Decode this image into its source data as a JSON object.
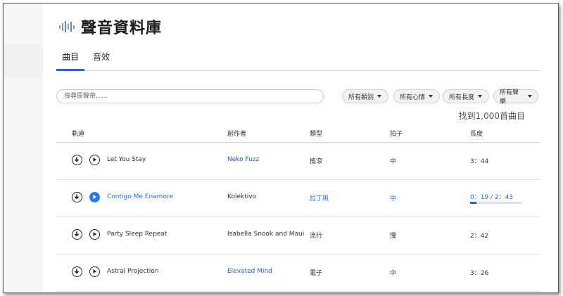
{
  "app": {
    "title": "聲音資料庫"
  },
  "tabs": [
    {
      "label": "曲目",
      "active": true
    },
    {
      "label": "音效",
      "active": false
    }
  ],
  "search": {
    "placeholder": "搜尋原聲帶......",
    "value": ""
  },
  "filters": [
    {
      "label": "所有類別"
    },
    {
      "label": "所有心情"
    },
    {
      "label": "所有長度"
    },
    {
      "label": "所有聲樂"
    }
  ],
  "result_count": "找到1,000首曲目",
  "columns": {
    "track": "軌道",
    "artist": "創作者",
    "genre": "類型",
    "tempo": "拍子",
    "length": "長度"
  },
  "tracks": [
    {
      "title": "Let You Stay",
      "artist": "Neko Fuzz",
      "genre": "搖滾",
      "tempo": "中",
      "length": "3：44",
      "playing": false
    },
    {
      "title": "Contigo Me Enamore",
      "artist": "Kolektivo",
      "genre": "拉丁風",
      "tempo": "中",
      "length": "0：19 / 2：43",
      "playing": true,
      "progress": 0.12
    },
    {
      "title": "Party Sleep Repeat",
      "artist": "Isabella Snook and Maui",
      "genre": "流行",
      "tempo": "慢",
      "length": "2：42",
      "playing": false
    },
    {
      "title": "Astral Projection",
      "artist": "Elevated Mind",
      "genre": "電子",
      "tempo": "中",
      "length": "3：26",
      "playing": false
    }
  ],
  "icons": {
    "logo": "sound-wave-icon",
    "download": "download-icon",
    "play": "play-icon"
  },
  "colors": {
    "accent": "#2a63c9",
    "active_text": "#2a6fd6",
    "link": "#2a5cc0"
  }
}
